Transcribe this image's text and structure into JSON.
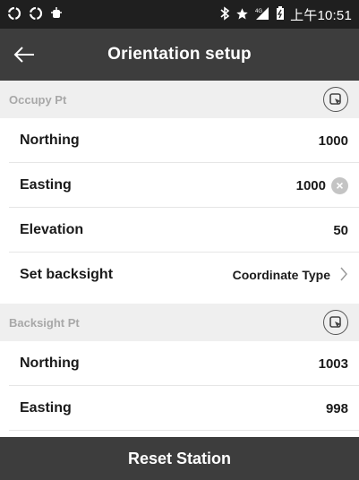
{
  "status_bar": {
    "left_icons": [
      "sync-icon",
      "sync-icon",
      "android-debug-icon"
    ],
    "right_icons": [
      "bluetooth-icon",
      "star-icon",
      "signal-4g-icon",
      "battery-icon"
    ],
    "time": "上午10:51"
  },
  "header": {
    "title": "Orientation setup",
    "back_icon": "arrow-left-icon"
  },
  "occupy_section": {
    "label": "Occupy Pt",
    "select_icon": "select-point-icon"
  },
  "occupy_rows": [
    {
      "label": "Northing",
      "value": "1000"
    },
    {
      "label": "Easting",
      "value": "1000"
    },
    {
      "label": "Elevation",
      "value": "50"
    }
  ],
  "backsight_setting": {
    "label": "Set backsight",
    "value": "Coordinate Type"
  },
  "backsight_section": {
    "label": "Backsight Pt",
    "select_icon": "select-point-icon"
  },
  "backsight_rows": [
    {
      "label": "Northing",
      "value": "1003"
    },
    {
      "label": "Easting",
      "value": "998"
    }
  ],
  "footer": {
    "button_label": "Reset Station"
  },
  "colors": {
    "title_bar": "#3d3d3d",
    "status_bar": "#1f1f1f",
    "section_bg": "#efefef",
    "section_text": "#a8a8a8"
  }
}
